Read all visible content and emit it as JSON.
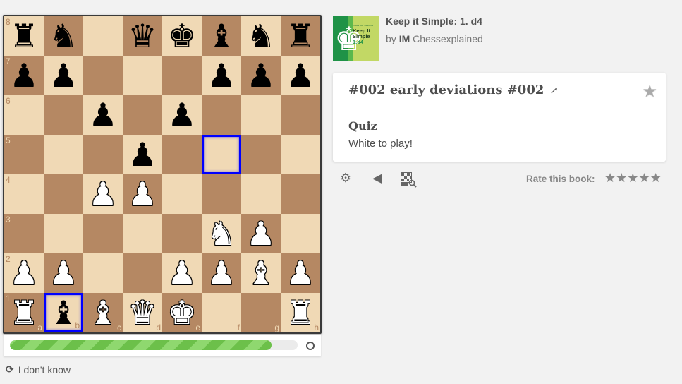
{
  "book": {
    "title": "Keep it Simple: 1. d4",
    "author_prefix": "by",
    "author_title": "IM",
    "author_name": "Chessexplained",
    "cover": {
      "small_caption": "CHRISTOF SIELECKI",
      "line1": "Keep It",
      "line2": "Simple",
      "line3": "1.d4"
    }
  },
  "chapter": {
    "title": "#002 early deviations #002",
    "external_link_icon": "external-link-icon",
    "favorite_icon": "star-icon",
    "quiz_label": "Quiz",
    "quiz_text": "White to play!"
  },
  "toolbar": {
    "settings_icon": "gear-icon",
    "sound_icon": "speaker-icon",
    "analysis_icon": "board-search-icon",
    "rate_label": "Rate this book:",
    "rating_stars": 5,
    "rating_value": 0
  },
  "progress": {
    "percent": 91
  },
  "dont_know": {
    "label": "I don't know",
    "icon": "refresh-icon"
  },
  "board": {
    "orientation": "white",
    "colors": {
      "light": "#f0d9b5",
      "dark": "#b58863",
      "highlight": "#0000ff"
    },
    "files": [
      "a",
      "b",
      "c",
      "d",
      "e",
      "f",
      "g",
      "h"
    ],
    "ranks": [
      "8",
      "7",
      "6",
      "5",
      "4",
      "3",
      "2",
      "1"
    ],
    "position": [
      [
        "r",
        "n",
        "",
        "q",
        "k",
        "b",
        "n",
        "r"
      ],
      [
        "p",
        "p",
        "",
        "",
        "",
        "p",
        "p",
        "p"
      ],
      [
        "",
        "",
        "p",
        "",
        "p",
        "",
        "",
        ""
      ],
      [
        "",
        "",
        "",
        "p",
        "",
        "",
        "",
        ""
      ],
      [
        "",
        "",
        "P",
        "P",
        "",
        "",
        "",
        ""
      ],
      [
        "",
        "",
        "",
        "",
        "",
        "N",
        "P",
        ""
      ],
      [
        "P",
        "P",
        "",
        "",
        "P",
        "P",
        "B",
        "P"
      ],
      [
        "R",
        "b",
        "B",
        "Q",
        "K",
        "",
        "",
        "R"
      ]
    ],
    "highlighted_squares": [
      "f5",
      "b1"
    ]
  }
}
